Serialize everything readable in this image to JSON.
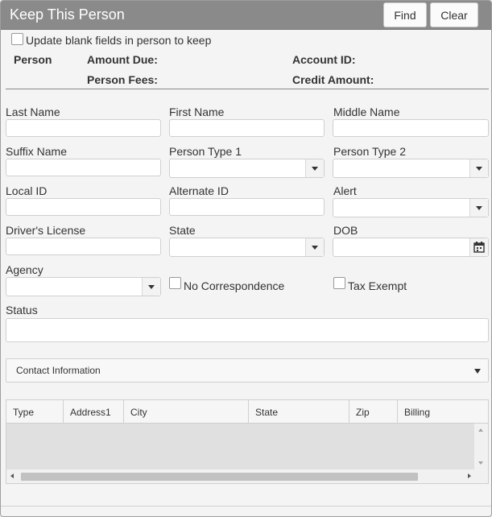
{
  "titlebar": {
    "title": "Keep This Person",
    "find_label": "Find",
    "clear_label": "Clear"
  },
  "options": {
    "update_blank_label": "Update blank fields in person to keep"
  },
  "summary": {
    "person_label": "Person",
    "amount_due_label": "Amount Due:",
    "account_id_label": "Account ID:",
    "person_fees_label": "Person Fees:",
    "credit_amount_label": "Credit Amount:"
  },
  "fields": {
    "last_name": "Last Name",
    "first_name": "First Name",
    "middle_name": "Middle Name",
    "suffix_name": "Suffix Name",
    "person_type_1": "Person Type 1",
    "person_type_2": "Person Type 2",
    "local_id": "Local ID",
    "alternate_id": "Alternate ID",
    "alert": "Alert",
    "drivers_license": "Driver's License",
    "state": "State",
    "dob": "DOB",
    "agency": "Agency",
    "no_correspondence": "No Correspondence",
    "tax_exempt": "Tax Exempt",
    "status": "Status"
  },
  "contact": {
    "section_label": "Contact Information",
    "columns": [
      "Type",
      "Address1",
      "City",
      "State",
      "Zip",
      "Billing"
    ]
  },
  "icons": {
    "dropdown": "chevron-down-icon",
    "calendar": "calendar-icon"
  }
}
